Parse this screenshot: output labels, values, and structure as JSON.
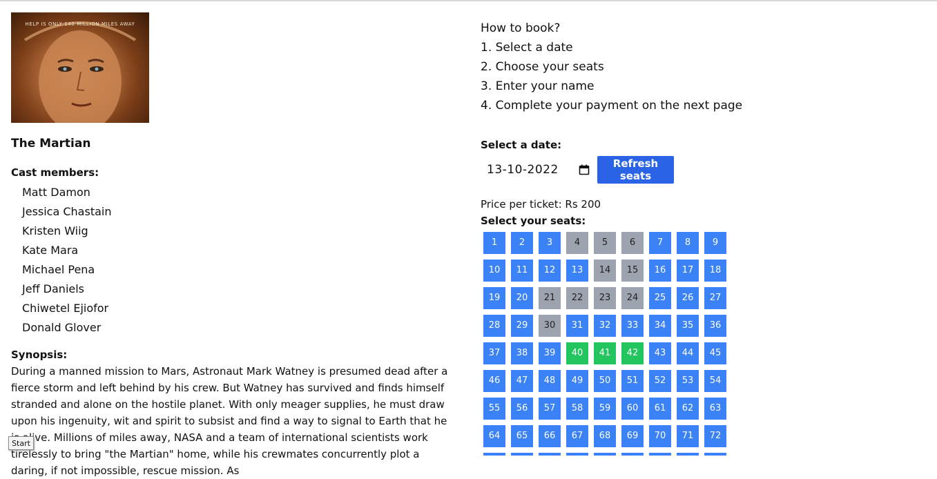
{
  "movie": {
    "poster_tagline": "HELP IS ONLY 140 MILLION MILES AWAY",
    "title": "The Martian",
    "cast_heading": "Cast members:",
    "cast": [
      "Matt Damon",
      "Jessica Chastain",
      "Kristen Wiig",
      "Kate Mara",
      "Michael Pena",
      "Jeff Daniels",
      "Chiwetel Ejiofor",
      "Donald Glover"
    ],
    "synopsis_heading": "Synopsis:",
    "synopsis": "During a manned mission to Mars, Astronaut Mark Watney is presumed dead after a fierce storm and left behind by his crew. But Watney has survived and finds himself stranded and alone on the hostile planet. With only meager supplies, he must draw upon his ingenuity, wit and spirit to subsist and find a way to signal to Earth that he is alive. Millions of miles away, NASA and a team of international scientists work tirelessly to bring \"the Martian\" home, while his crewmates concurrently plot a daring, if not impossible, rescue mission. As"
  },
  "instructions": {
    "heading": "How to book?",
    "steps": [
      "1. Select a date",
      "2. Choose your seats",
      "3. Enter your name",
      "4. Complete your payment on the next page"
    ]
  },
  "booking": {
    "date_label": "Select a date:",
    "date_value": "13-10-2022",
    "refresh_label": "Refresh seats",
    "price_text": "Price per ticket: Rs 200",
    "seats_label": "Select your seats:"
  },
  "seats": {
    "visible_numbers": [
      1,
      2,
      3,
      4,
      5,
      6,
      7,
      8,
      9,
      10,
      11,
      12,
      13,
      14,
      15,
      16,
      17,
      18,
      19,
      20,
      21,
      22,
      23,
      24,
      25,
      26,
      27,
      28,
      29,
      30,
      31,
      32,
      33,
      34,
      35,
      36,
      37,
      38,
      39,
      40,
      41,
      42,
      43,
      44,
      45,
      46,
      47,
      48,
      49,
      50,
      51,
      52,
      53,
      54,
      55,
      56,
      57,
      58,
      59,
      60,
      61,
      62,
      63,
      64,
      65,
      66,
      67,
      68,
      69,
      70,
      71,
      72
    ],
    "booked": [
      4,
      5,
      6,
      14,
      15,
      21,
      22,
      23,
      24,
      30
    ],
    "selected": [
      40,
      41,
      42
    ],
    "colors": {
      "available": "#3b82f6",
      "booked": "#9ca3af",
      "selected": "#22c55e"
    }
  },
  "taskbar": {
    "start_label": "Start"
  },
  "icons": {
    "date_picker": "calendar-icon"
  }
}
